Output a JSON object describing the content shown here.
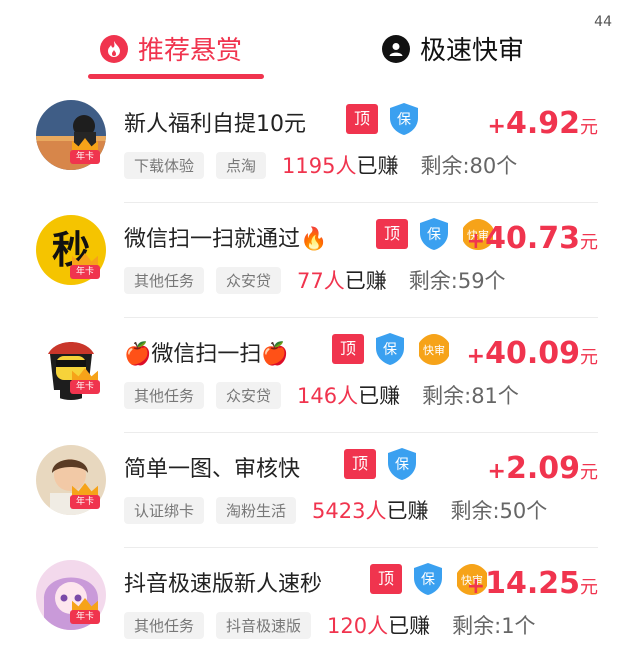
{
  "status": {
    "count": "44"
  },
  "tabs": [
    {
      "label": "推荐悬赏",
      "active": true,
      "icon": "flame-icon"
    },
    {
      "label": "极速快审",
      "active": false,
      "icon": "user-circle-icon"
    }
  ],
  "colors": {
    "accent": "#f0344e",
    "shield": "#3aa0f0",
    "fast": "#f6a319"
  },
  "tags": {
    "top": "顶",
    "shield": "保",
    "fast": "快审"
  },
  "avatar_badge": "年卡",
  "tasks": [
    {
      "title": "新人福利自提10元",
      "chips": [
        "下载体验",
        "点淘"
      ],
      "earned_num": "1195人",
      "earned_suffix": "已赚",
      "remain": "剩余:80个",
      "price_sign": "+",
      "price_amount": "4.92",
      "price_unit": "元",
      "has_fast": false
    },
    {
      "title": "微信扫一扫就通过🔥",
      "chips": [
        "其他任务",
        "众安贷"
      ],
      "earned_num": "77人",
      "earned_suffix": "已赚",
      "remain": "剩余:59个",
      "price_sign": "+",
      "price_amount": "40.73",
      "price_unit": "元",
      "has_fast": true
    },
    {
      "title": "🍎微信扫一扫🍎",
      "chips": [
        "其他任务",
        "众安贷"
      ],
      "earned_num": "146人",
      "earned_suffix": "已赚",
      "remain": "剩余:81个",
      "price_sign": "+",
      "price_amount": "40.09",
      "price_unit": "元",
      "has_fast": true
    },
    {
      "title": "简单一图、审核快",
      "chips": [
        "认证绑卡",
        "淘粉生活"
      ],
      "earned_num": "5423人",
      "earned_suffix": "已赚",
      "remain": "剩余:50个",
      "price_sign": "+",
      "price_amount": "2.09",
      "price_unit": "元",
      "has_fast": false
    },
    {
      "title": "抖音极速版新人速秒",
      "chips": [
        "其他任务",
        "抖音极速版"
      ],
      "earned_num": "120人",
      "earned_suffix": "已赚",
      "remain": "剩余:1个",
      "price_sign": "+",
      "price_amount": "14.25",
      "price_unit": "元",
      "has_fast": true
    }
  ]
}
